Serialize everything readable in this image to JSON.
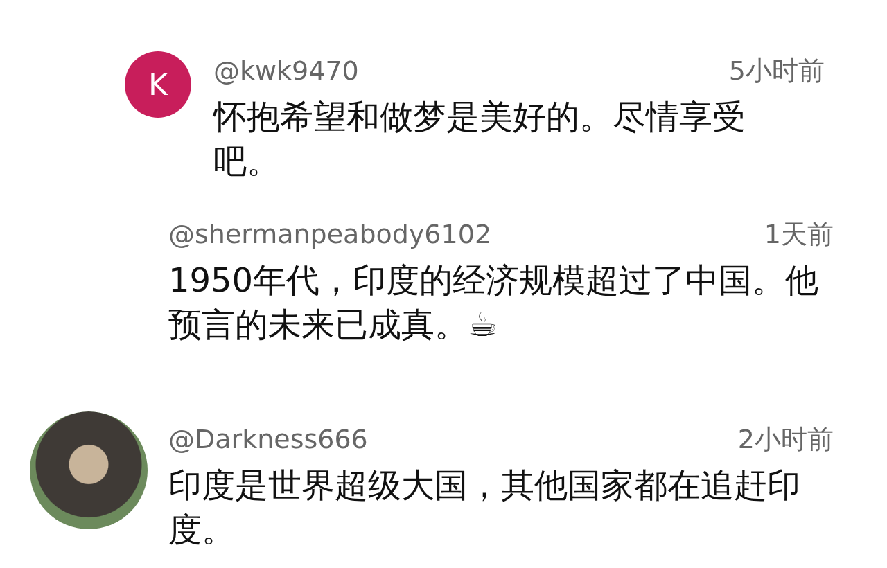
{
  "comments": [
    {
      "kind": "top",
      "avatar": {
        "kind": "letter",
        "letter": "K",
        "color": "#c81e5b"
      },
      "username": "@kwk9470",
      "time": "5小时前",
      "text": "怀抱希望和做梦是美好的。尽情享受吧。"
    },
    {
      "kind": "reply",
      "username": "@shermanpeabody6102",
      "time": "1天前",
      "text": "1950年代，印度的经济规模超过了中国。他预言的未来已成真。☕"
    },
    {
      "kind": "top_wide",
      "avatar": {
        "kind": "photo"
      },
      "username": "@Darkness666",
      "time": "2小时前",
      "text": "印度是世界超级大国，其他国家都在追赶印度。"
    }
  ]
}
